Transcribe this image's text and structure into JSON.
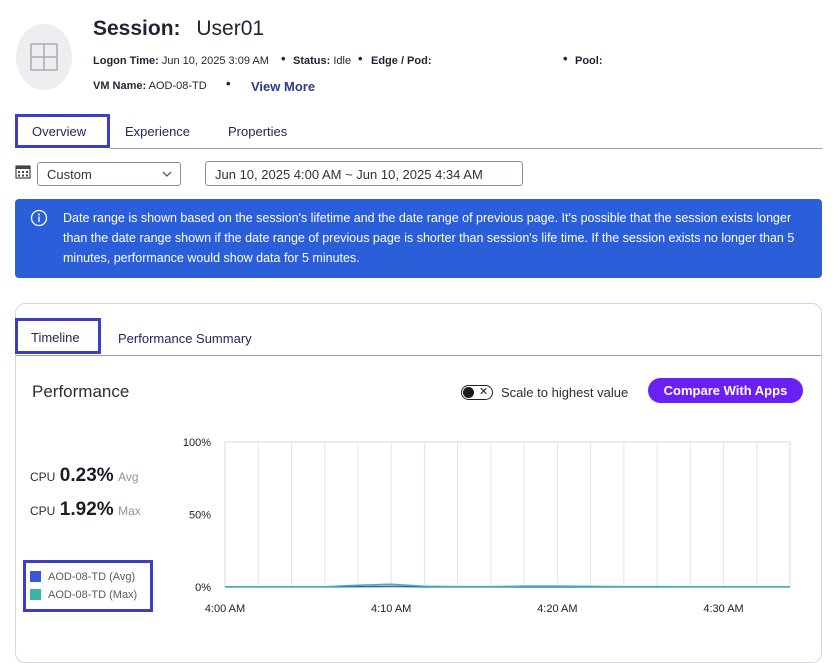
{
  "session": {
    "title_label": "Session:",
    "title_value": "User01",
    "logon_label": "Logon Time:",
    "logon_value": "Jun 10, 2025 3:09 AM",
    "status_label": "Status:",
    "status_value": "Idle",
    "edge_label": "Edge / Pod:",
    "pool_label": "Pool:",
    "vm_label": "VM Name:",
    "vm_value": "AOD-08-TD",
    "view_more": "View More",
    "separator": "•"
  },
  "tabs": [
    "Overview",
    "Experience",
    "Properties"
  ],
  "range": {
    "select_value": "Custom",
    "date_range": "Jun 10, 2025 4:00 AM ~ Jun 10, 2025 4:34 AM"
  },
  "banner_text": "Date range is shown based on the session's lifetime and the date range of previous page. It's possible that the session exists longer than the date range shown if the date range of previous page is shorter than session's life time. If the session exists no longer than 5 minutes, performance would show data for 5 minutes.",
  "card_tabs": [
    "Timeline",
    "Performance Summary"
  ],
  "performance": {
    "title": "Performance",
    "toggle_label": "Scale to highest value",
    "toggle_on": false,
    "compare_button": "Compare With Apps",
    "stats": [
      {
        "label": "CPU",
        "value": "0.23%",
        "kind": "Avg"
      },
      {
        "label": "CPU",
        "value": "1.92%",
        "kind": "Max"
      }
    ]
  },
  "colors": {
    "accent": "#6a1ff5",
    "banner": "#2b5fd9",
    "highlight": "#3c3fc4",
    "series_avg": "#3558d4",
    "series_max": "#3bb3a5"
  },
  "chart_data": {
    "type": "line",
    "x": [
      "4:00 AM",
      "4:02 AM",
      "4:04 AM",
      "4:06 AM",
      "4:08 AM",
      "4:10 AM",
      "4:12 AM",
      "4:14 AM",
      "4:16 AM",
      "4:18 AM",
      "4:20 AM",
      "4:22 AM",
      "4:24 AM",
      "4:26 AM",
      "4:28 AM",
      "4:30 AM",
      "4:32 AM",
      "4:34 AM"
    ],
    "xticks": [
      "4:00 AM",
      "4:10 AM",
      "4:20 AM",
      "4:30 AM"
    ],
    "yticks": [
      "100%",
      "50%",
      "0%"
    ],
    "ylim": [
      0,
      100
    ],
    "grid": true,
    "series": [
      {
        "name": "AOD-08-TD (Avg)",
        "color": "#3558d4",
        "values": [
          0.1,
          0.1,
          0.1,
          0.1,
          0.3,
          0.4,
          0.1,
          0.1,
          0.1,
          0.1,
          0.1,
          0.1,
          0.1,
          0.1,
          0.1,
          0.1,
          0.1,
          0.1
        ]
      },
      {
        "name": "AOD-08-TD (Max)",
        "color": "#3bb3a5",
        "values": [
          0.2,
          0.2,
          0.2,
          0.2,
          1.2,
          1.9,
          0.5,
          0.3,
          0.3,
          0.6,
          0.6,
          0.4,
          0.3,
          0.3,
          0.2,
          0.2,
          0.2,
          0.2
        ]
      }
    ]
  }
}
